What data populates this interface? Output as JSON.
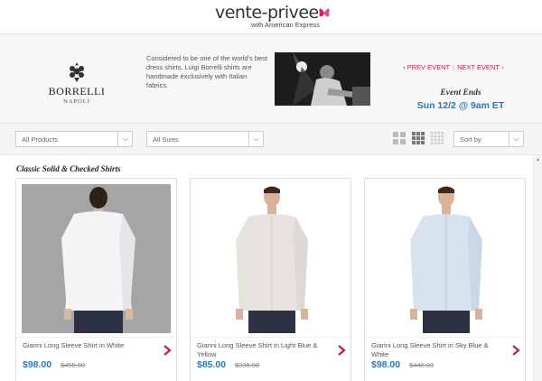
{
  "header": {
    "logo_text": "vente-privee",
    "logo_sub": "with American Express"
  },
  "banner": {
    "brand_name": "BORRELLI",
    "brand_sub": "NAPOLI",
    "description": "Considered to be one of the world's best dress shirts, Luigi Borrelli shirts are handmade exclusively with Italian fabrics.",
    "prev_event": "PREV EVENT",
    "next_event": "NEXT EVENT",
    "event_ends_label": "Event Ends",
    "event_ends_date": "Sun 12/2 @ 9am ET"
  },
  "filters": {
    "products": "All Products",
    "sizes": "All Sizes",
    "sort": "Sort by"
  },
  "section": {
    "title": "Classic Solid & Checked Shirts"
  },
  "products": [
    {
      "name": "Gianni Long Sleeve Shirt in White",
      "price": "$98.00",
      "original_price": "$455.00",
      "shirt_color": "#f4f4f6"
    },
    {
      "name": "Gianni Long Sleeve Shirt in Light Blue & Yellow",
      "price": "$85.00",
      "original_price": "$335.00",
      "shirt_color": "#e6e3de"
    },
    {
      "name": "Gianni Long Sleeve Shirt in Sky Blue & White",
      "price": "$98.00",
      "original_price": "$446.00",
      "shirt_color": "#d7e2ef"
    }
  ],
  "colors": {
    "accent": "#c2185b",
    "price": "#2a7ab8"
  }
}
